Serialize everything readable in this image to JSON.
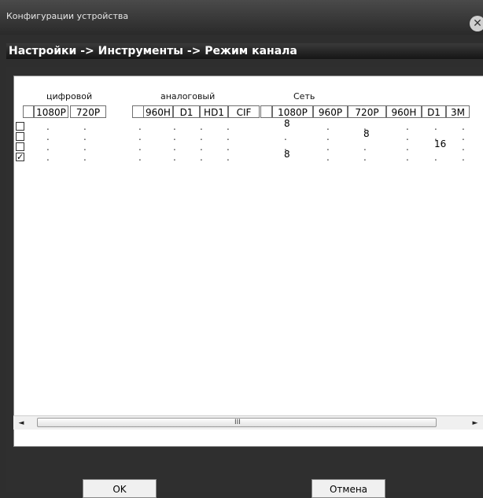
{
  "window": {
    "title": "Конфигурации устройства"
  },
  "breadcrumb": "Настройки -> Инструменты -> Режим канала",
  "groups": {
    "digital": "цифровой",
    "analog": "аналоговый",
    "network": "Сеть"
  },
  "columns": [
    "1080P",
    "720P",
    "960H",
    "D1",
    "HD1",
    "CIF",
    "1080P",
    "960P",
    "720P",
    "960H",
    "D1",
    "3M"
  ],
  "rows": [
    {
      "checked": false,
      "cells": [
        ".",
        ".",
        ".",
        ".",
        ".",
        ".",
        "8",
        ".",
        ".",
        ".",
        ".",
        "."
      ]
    },
    {
      "checked": false,
      "cells": [
        ".",
        ".",
        ".",
        ".",
        ".",
        ".",
        ".",
        ".",
        "8",
        ".",
        ".",
        "."
      ]
    },
    {
      "checked": false,
      "cells": [
        ".",
        ".",
        ".",
        ".",
        ".",
        ".",
        ".",
        ".",
        ".",
        ".",
        "16",
        "."
      ]
    },
    {
      "checked": true,
      "cells": [
        ".",
        ".",
        ".",
        ".",
        ".",
        ".",
        "8",
        ".",
        ".",
        ".",
        ".",
        "."
      ]
    }
  ],
  "scrollbar": {
    "left": "◄",
    "right": "►",
    "grip": "III"
  },
  "buttons": {
    "ok": "OK",
    "cancel": "Отмена"
  }
}
